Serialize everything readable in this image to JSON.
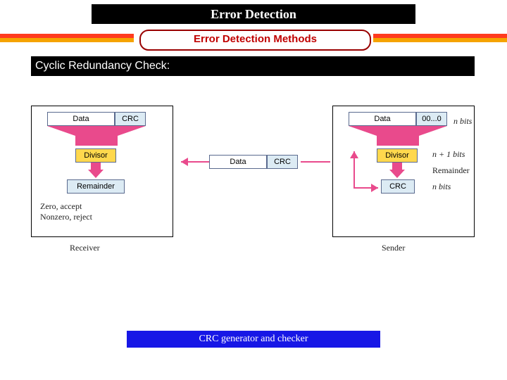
{
  "title": "Error Detection",
  "subtitle": "Error Detection Methods",
  "section": "Cyclic Redundancy Check:",
  "receiver": {
    "data": "Data",
    "crc": "CRC",
    "divisor": "Divisor",
    "remainder": "Remainder",
    "zero": "Zero, accept",
    "nonzero": "Nonzero, reject",
    "label": "Receiver"
  },
  "sender": {
    "data": "Data",
    "zeros": "00...0",
    "nbits": "n bits",
    "divisor": "Divisor",
    "divbits": "n + 1 bits",
    "crc": "CRC",
    "rembits": "n bits",
    "remainder": "Remainder",
    "label": "Sender"
  },
  "mid": {
    "data": "Data",
    "crc": "CRC"
  },
  "caption": "CRC generator and checker"
}
